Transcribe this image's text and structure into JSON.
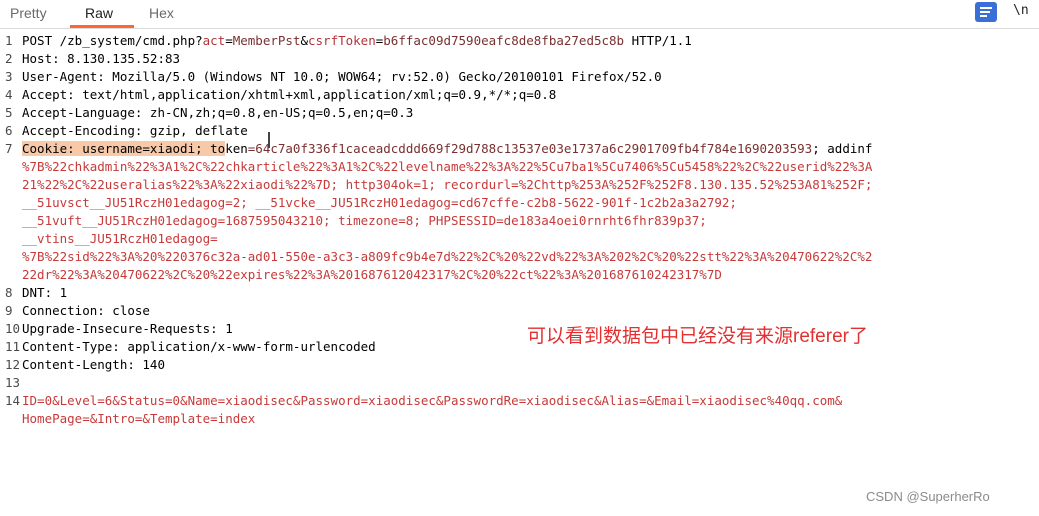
{
  "tabs": [
    "Pretty",
    "Raw",
    "Hex"
  ],
  "active_tab": "Raw",
  "toolbar": {
    "newline_label": "\\n",
    "wrap_icon": "wrap-lines-icon"
  },
  "colors": {
    "accent": "#ff6633",
    "highlight": "#f7c9a9",
    "annotation": "#e23030"
  },
  "line_numbers": [
    "1",
    "2",
    "3",
    "4",
    "5",
    "6",
    "7",
    "",
    "",
    "",
    "",
    "",
    "",
    "8",
    "9",
    "10",
    "11",
    "12",
    "13",
    "14",
    ""
  ],
  "request": {
    "l1_a": "POST /zb_system/cmd.php?",
    "l1_k1": "act",
    "l1_eq": "=",
    "l1_v1": "MemberPst",
    "l1_amp": "&",
    "l1_k2": "csrfToken",
    "l1_v2": "b6ffac09d7590eafc8de8fba27ed5c8b",
    "l1_b": " HTTP/1.1",
    "l2": "Host: 8.130.135.52:83",
    "l3": "User-Agent: Mozilla/5.0 (Windows NT 10.0; WOW64; rv:52.0) Gecko/20100101 Firefox/52.0",
    "l4": "Accept: text/html,application/xhtml+xml,application/xml;q=0.9,*/*;q=0.8",
    "l5": "Accept-Language: zh-CN,zh;q=0.8,en-US;q=0.5,en;q=0.3",
    "l6": "Accept-Encoding: gzip, deflate",
    "l7_hl": "Cookie: username=xiaodi; to",
    "l7_rest_k": "ken",
    "l7_rest_v": "=64c7a0f336f1caceadcddd669f29d788c13537e03e1737a6c2901709fb4f784e1690203593",
    "l7_rest_tail": "; addinf",
    "w1": "%7B%22chkadmin%22%3A1%2C%22chkarticle%22%3A1%2C%22levelname%22%3A%22%5Cu7ba1%5Cu7406%5Cu5458%22%2C%22userid%22%3A",
    "w2": "21%22%2C%22useralias%22%3A%22xiaodi%22%7D; http304ok=1; recordurl=%2Chttp%253A%252F%252F8.130.135.52%253A81%252F;",
    "w3": "__51uvsct__JU51RczH01edagog=2; __51vcke__JU51RczH01edagog=cd67cffe-c2b8-5622-901f-1c2b2a3a2792;",
    "w4": "__51vuft__JU51RczH01edagog=1687595043210; timezone=8; PHPSESSID=de183a4oei0rnrht6fhr839p37;",
    "w5": "__vtins__JU51RczH01edagog=",
    "w6": "%7B%22sid%22%3A%20%220376c32a-ad01-550e-a3c3-a809fc9b4e7d%22%2C%20%22vd%22%3A%202%2C%20%22stt%22%3A%20470622%2C%2",
    "w7": "22dr%22%3A%20470622%2C%20%22expires%22%3A%201687612042317%2C%20%22ct%22%3A%201687610242317%7D",
    "l8": "DNT: 1",
    "l9": "Connection: close",
    "l10": "Upgrade-Insecure-Requests: 1",
    "l11": "Content-Type: application/x-www-form-urlencoded",
    "l12": "Content-Length: 140",
    "l13": "",
    "l14": "ID=0&Level=6&Status=0&Name=xiaodisec&Password=xiaodisec&PasswordRe=xiaodisec&Alias=&Email=xiaodisec%40qq.com&",
    "l14b": "HomePage=&Intro=&Template=index"
  },
  "annotation": "可以看到数据包中已经没有来源referer了",
  "watermark": "CSDN @SuperherRo"
}
